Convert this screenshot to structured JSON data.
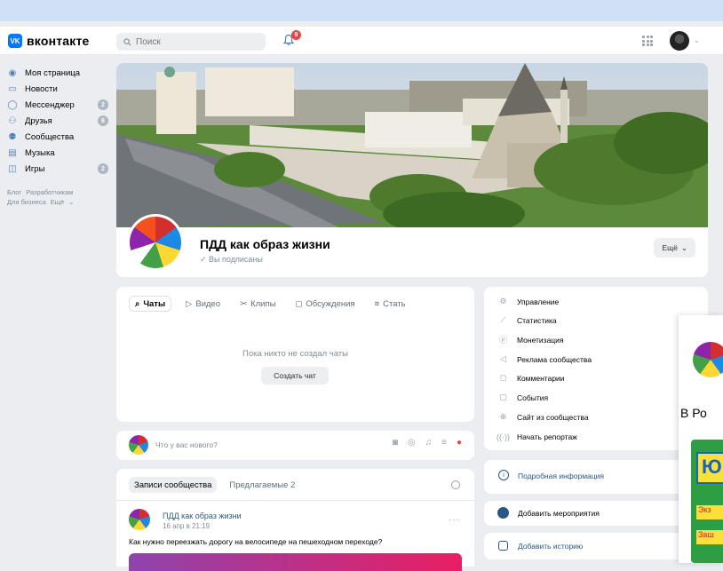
{
  "header": {
    "logo_text": "вконтакте",
    "search_placeholder": "Поиск",
    "notification_count": "9"
  },
  "sidebar": {
    "items": [
      {
        "label": "Моя страница",
        "icon": "user-icon",
        "count": ""
      },
      {
        "label": "Новости",
        "icon": "news-icon",
        "count": ""
      },
      {
        "label": "Мессенджер",
        "icon": "chat-icon",
        "count": "2"
      },
      {
        "label": "Друзья",
        "icon": "friends-icon",
        "count": "6"
      },
      {
        "label": "Сообщества",
        "icon": "community-icon",
        "count": ""
      },
      {
        "label": "Музыка",
        "icon": "music-icon",
        "count": ""
      },
      {
        "label": "Игры",
        "icon": "gamepad-icon",
        "count": "2"
      }
    ],
    "footer_line1": [
      "Блог",
      "Разработчикам"
    ],
    "footer_line2": [
      "Для бизнеса",
      "Ещё"
    ]
  },
  "group": {
    "name": "ПДД как образ жизни",
    "subscribed": "Вы подписаны",
    "more_label": "Ещё"
  },
  "content": {
    "tabs": [
      "Чаты",
      "Видео",
      "Клипы",
      "Обсуждения",
      "Стать"
    ],
    "empty_text": "Пока никто не создал чаты",
    "create_button": "Создать чат"
  },
  "composer": {
    "placeholder": "Что у вас нового?"
  },
  "wall": {
    "tabs": [
      "Записи сообщества",
      "Предлагаемые 2"
    ],
    "post": {
      "author": "ПДД как образ жизни",
      "date": "16 апр в 21:19",
      "text": "Как нужно переезжать дорогу на велосипеде на пешеходном переходе?"
    }
  },
  "admin_menu": {
    "items": [
      {
        "label": "Управление",
        "icon": "gear-icon"
      },
      {
        "label": "Статистика",
        "icon": "chart-icon"
      },
      {
        "label": "Монетизация",
        "icon": "coin-icon"
      },
      {
        "label": "Реклама сообщества",
        "icon": "megaphone-icon"
      },
      {
        "label": "Комментарии",
        "icon": "comment-icon"
      },
      {
        "label": "События",
        "icon": "calendar-icon"
      },
      {
        "label": "Сайт из сообщества",
        "icon": "globe-icon"
      },
      {
        "label": "Начать репортаж",
        "icon": "broadcast-icon"
      }
    ]
  },
  "side_actions": {
    "info": "Подробная информация",
    "event": "Добавить мероприятия",
    "story": "Добавить историю"
  },
  "overlay": {
    "text": "В Ро",
    "logo_letters": "Ю",
    "btn1": "Экз",
    "btn2": "Заш"
  },
  "colors": {
    "accent": "#0077ff",
    "link": "#2a5885",
    "background": "#ebedf0"
  }
}
